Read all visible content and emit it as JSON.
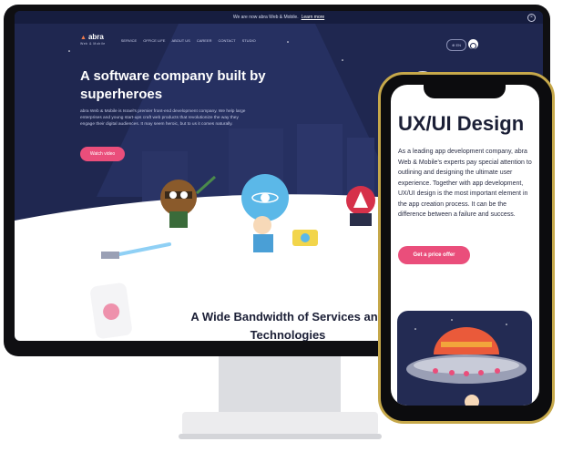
{
  "banner": {
    "text": "We are now abra Web & Mobile.",
    "link": "Learn more"
  },
  "logo": {
    "name": "abra",
    "tagline": "Web & Mobile"
  },
  "nav": {
    "items": [
      "SERVICE",
      "OFFICE LIFE",
      "ABOUT US",
      "CAREER",
      "CONTACT",
      "STUDIO"
    ],
    "lang": "EN"
  },
  "hero": {
    "title": "A software company built by superheroes",
    "text": "abra Web & Mobile is Israel's premier front-end development company. We help large enterprises and young start-ups craft web products that revolutionize the way they engage their digital audiences. It may seem heroic, but to us it comes naturally.",
    "button": "Watch video"
  },
  "services": {
    "title": "A Wide Bandwidth of Services and Technologies"
  },
  "phone": {
    "title": "UX/UI Design",
    "text": "As a leading app development company, abra Web & Mobile's experts pay special attention to outlining and designing the ultimate user experience. Together with app development, UX/UI design is the most important element in the app creation process. It can be the difference between a failure and success.",
    "button": "Get a price offer"
  },
  "colors": {
    "accent": "#ea4e7b",
    "navy": "#1f2750",
    "frame_gold": "#c6a84a"
  }
}
